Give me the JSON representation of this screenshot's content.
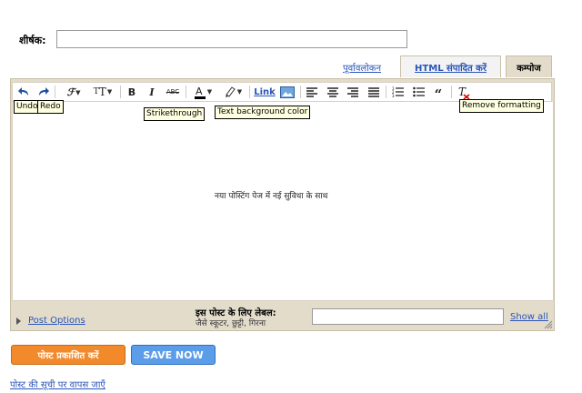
{
  "form": {
    "title_label": "शीर्षक:",
    "title_value": ""
  },
  "tabs": {
    "preview": "पूर्वावलोकन",
    "html_edit": "HTML संपादित करें",
    "compose": "कम्पोज"
  },
  "toolbar": {
    "undo_icon": "undo-icon",
    "redo_icon": "redo-icon",
    "link_label": "Link"
  },
  "tooltips": {
    "undo": "Undo",
    "redo": "Redo",
    "strikethrough": "Strikethrough",
    "text_background_color": "Text background color",
    "remove_formatting": "Remove formatting"
  },
  "editor": {
    "body_text": "नया पोस्टिंग पेज में नई सुविधा के साथ"
  },
  "post_options": {
    "label": "Post Options"
  },
  "labels": {
    "title": "इस पोस्ट के लिए लेबल:",
    "hint": "जैसे स्कूटर, छुट्टी, गिरना",
    "value": "",
    "show_all": "Show all"
  },
  "actions": {
    "publish": "पोस्ट प्रकाशित करें",
    "save": "SAVE NOW",
    "back": "पोस्ट की सूची पर वापस जाएँ"
  },
  "colors": {
    "accent_link": "#2a55b8",
    "publish_bg": "#f28a2b",
    "save_bg": "#5b9de8",
    "frame_bg": "#e3dccb"
  }
}
